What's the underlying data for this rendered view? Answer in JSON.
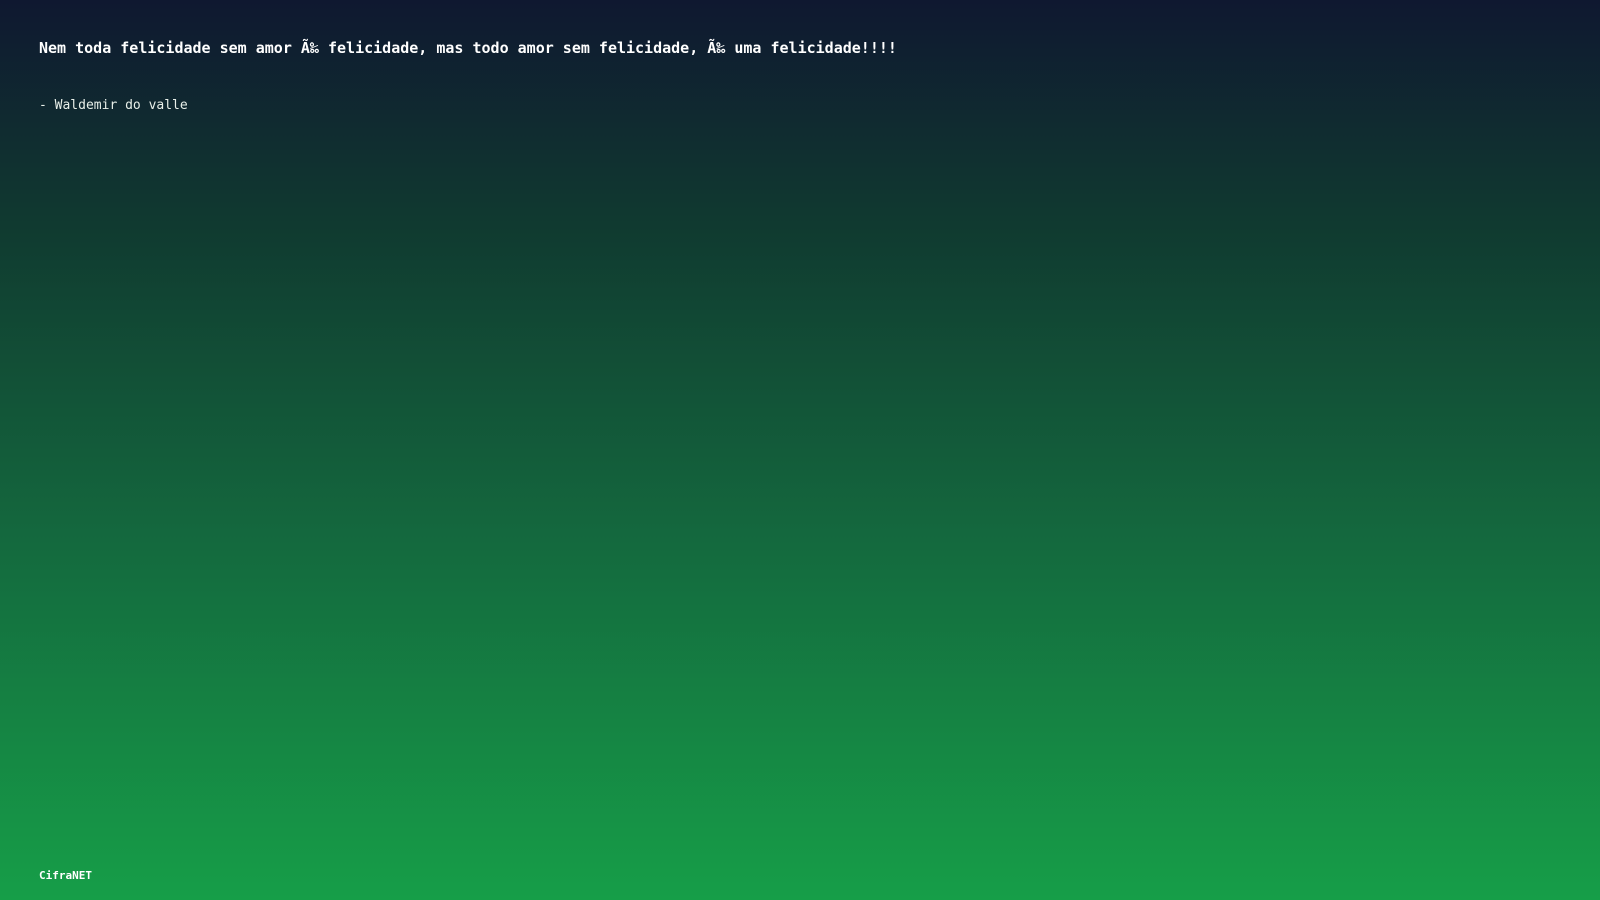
{
  "quote": {
    "text": "Nem toda felicidade sem amor Ã‰ felicidade, mas todo amor sem felicidade, Ã‰ uma felicidade!!!!"
  },
  "author": {
    "text": "- Waldemir do valle"
  },
  "brand": {
    "text": "CifraNET"
  },
  "colors": {
    "gradient_top": "#0f1830",
    "gradient_bottom": "#169e48",
    "text": "#ffffff"
  }
}
